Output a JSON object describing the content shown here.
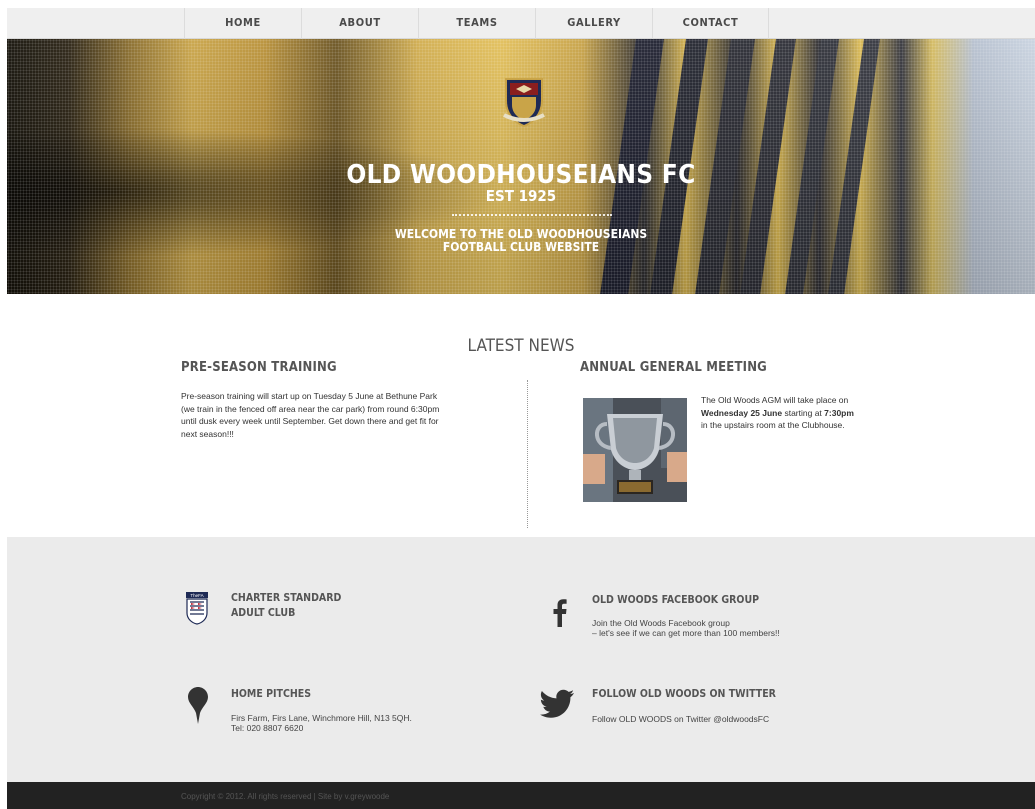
{
  "nav": {
    "items": [
      "HOME",
      "ABOUT",
      "TEAMS",
      "GALLERY",
      "CONTACT"
    ]
  },
  "hero": {
    "title": "OLD WOODHOUSEIANS FC",
    "subtitle": "EST 1925",
    "welcome_line1": "WELCOME TO THE OLD WOODHOUSEIANS",
    "welcome_line2": "FOOTBALL CLUB WEBSITE"
  },
  "news": {
    "heading": "LATEST NEWS",
    "articles": [
      {
        "title": "PRE-SEASON TRAINING",
        "lines": [
          "Pre-season training will start up on Tuesday 5 June at Bethune Park",
          "(we train in the fenced off area near the car park) from round 6:30pm",
          "until dusk every week until September. Get down there and get fit for",
          "next season!!!"
        ]
      },
      {
        "title": "ANNUAL GENERAL MEETING",
        "line1": "The Old Woods AGM will take place on",
        "date_bold": "Wednesday 25 June",
        "starting_at": " starting at ",
        "time_bold": "7:30pm",
        "line3": "in the upstairs room at the Clubhouse."
      }
    ]
  },
  "info": {
    "charter": {
      "line1": "CHARTER STANDARD",
      "line2": "ADULT CLUB",
      "badge_text": "TheFA"
    },
    "facebook": {
      "title": "OLD WOODS FACEBOOK GROUP",
      "line1": "Join the Old Woods Facebook group",
      "line2": "– let's see if we can get more than 100 members!!"
    },
    "pitches": {
      "title": "HOME PITCHES",
      "line1": "Firs Farm, Firs Lane, Winchmore Hill, N13 5QH.",
      "line2": "Tel: 020 8807 6620"
    },
    "twitter": {
      "title": "FOLLOW OLD WOODS ON TWITTER",
      "line1": "Follow OLD WOODS on Twitter @oldwoodsFC"
    }
  },
  "footer": {
    "copyright": "Copyright © 2012. All rights reserved | Site by v.greywoode"
  },
  "colors": {
    "nav_bg": "#efefef",
    "info_bg": "#ebebeb",
    "footer_bg": "#222222",
    "heading_gray": "#555555",
    "club_gold": "#d4b24e",
    "club_navy": "#1e2a55"
  },
  "icons": [
    "fa-crest-icon",
    "facebook-icon",
    "map-pin-icon",
    "twitter-bird-icon",
    "club-crest-icon"
  ]
}
